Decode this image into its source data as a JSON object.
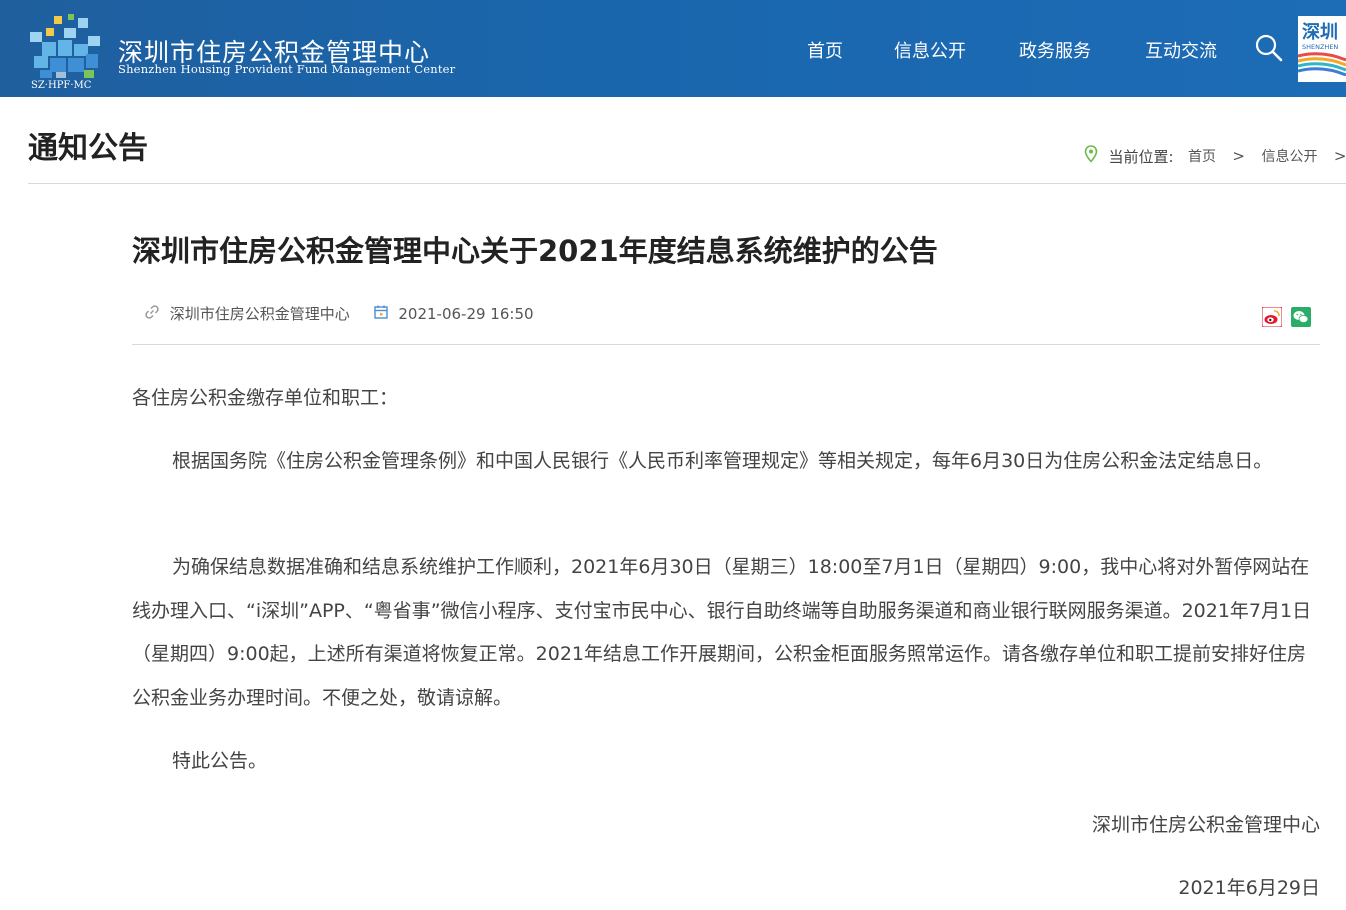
{
  "header": {
    "logo_cn": "深圳市住房公积金管理中心",
    "logo_en": "Shenzhen Housing Provident Fund Management Center",
    "logo_abbr": "SZ·HPF·MC",
    "brand_color": "#1c6cb6",
    "nav": [
      {
        "label": "首页"
      },
      {
        "label": "信息公开"
      },
      {
        "label": "政务服务"
      },
      {
        "label": "互动交流"
      }
    ],
    "search_icon": "search-icon",
    "city_badge_text": "深圳 SHENZHEN"
  },
  "section": {
    "title": "通知公告"
  },
  "breadcrumb": {
    "label": "当前位置:",
    "items": [
      "首页",
      "信息公开"
    ],
    "separator": ">",
    "icon": "location-pin-icon",
    "icon_color": "#6dbb4b"
  },
  "article": {
    "title": "深圳市住房公积金管理中心关于2021年度结息系统维护的公告",
    "source": "深圳市住房公积金管理中心",
    "datetime": "2021-06-29 16:50",
    "source_icon": "link-icon",
    "date_icon": "calendar-icon",
    "share": [
      {
        "icon": "weibo-icon",
        "color": "#e6162d"
      },
      {
        "icon": "wechat-icon",
        "color": "#2aae67"
      }
    ],
    "salutation": "各住房公积金缴存单位和职工：",
    "paragraphs": [
      "根据国务院《住房公积金管理条例》和中国人民银行《人民币利率管理规定》等相关规定，每年6月30日为住房公积金法定结息日。",
      "为确保结息数据准确和结息系统维护工作顺利，2021年6月30日（星期三）18:00至7月1日（星期四）9:00，我中心将对外暂停网站在线办理入口、“i深圳”APP、“粤省事”微信小程序、支付宝市民中心、银行自助终端等自助服务渠道和商业银行联网服务渠道。2021年7月1日（星期四）9:00起，上述所有渠道将恢复正常。2021年结息工作开展期间，公积金柜面服务照常运作。请各缴存单位和职工提前安排好住房公积金业务办理时间。不便之处，敬请谅解。",
      "特此公告。"
    ],
    "signature_org": "深圳市住房公积金管理中心",
    "signature_date": "2021年6月29日"
  }
}
